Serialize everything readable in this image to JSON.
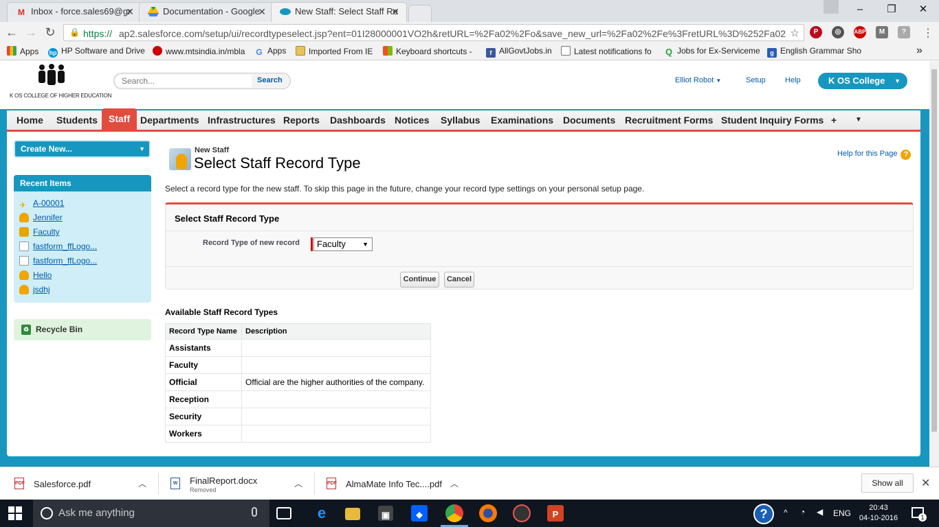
{
  "browser": {
    "tabs": [
      {
        "title": "Inbox - force.sales69@gr",
        "icon": "gmail-icon"
      },
      {
        "title": "Documentation - Google",
        "icon": "google-drive-icon"
      },
      {
        "title": "New Staff: Select Staff Re",
        "icon": "salesforce-cloud-icon"
      }
    ],
    "url_scheme": "https://",
    "url_rest": "ap2.salesforce.com/setup/ui/recordtypeselect.jsp?ent=01I28000001VO2h&retURL=%2Fa02%2Fo&save_new_url=%2Fa02%2Fe%3FretURL%3D%252Fa02%252F",
    "bookmarks": [
      "Apps",
      "HP Software and Drive",
      "www.mtsindia.in/mbla",
      "Apps",
      "Imported From IE",
      "Keyboard shortcuts -",
      "AllGovtJobs.in",
      "Latest notifications fo",
      "Jobs for Ex-Serviceme",
      "English Grammar Sho"
    ],
    "more_bookmarks": "»"
  },
  "sf": {
    "logo_caption": "K OS COLLEGE OF HIGHER EDUCATION",
    "search_placeholder": "Search...",
    "search_button": "Search",
    "user_menu": "Elliot Robot",
    "setup": "Setup",
    "help": "Help",
    "app_name": "K OS College",
    "nav_tabs": [
      "Home",
      "Students",
      "Staff",
      "Departments",
      "Infrastructures",
      "Reports",
      "Dashboards",
      "Notices",
      "Syllabus",
      "Examinations",
      "Documents",
      "Recruitment Forms",
      "Student Inquiry Forms"
    ],
    "nav_plus": "+",
    "active_tab": "Staff",
    "create_new": "Create New...",
    "recent_header": "Recent Items",
    "recent_items": [
      {
        "label": "A-00001",
        "icon": "plane-icon"
      },
      {
        "label": "Jennifer",
        "icon": "bell-icon"
      },
      {
        "label": "Faculty",
        "icon": "cylinder-icon"
      },
      {
        "label": "fastform_ffLogo...",
        "icon": "document-icon"
      },
      {
        "label": "fastform_ffLogo...",
        "icon": "document-icon"
      },
      {
        "label": "Hello",
        "icon": "bell-icon"
      },
      {
        "label": "jsdhj",
        "icon": "bell-icon"
      }
    ],
    "recycle_bin": "Recycle Bin",
    "page_type": "New Staff",
    "page_title": "Select Staff Record Type",
    "help_for_page": "Help for this Page",
    "instructions": "Select a record type for the new staff. To skip this page in the future, change your record type settings on your personal setup page.",
    "block_title": "Select Staff Record Type",
    "field_label": "Record Type of new record",
    "selected_record_type": "Faculty",
    "continue_btn": "Continue",
    "cancel_btn": "Cancel",
    "available_title": "Available Staff Record Types",
    "table_headers": [
      "Record Type Name",
      "Description"
    ],
    "table_rows": [
      {
        "name": "Assistants",
        "description": ""
      },
      {
        "name": "Faculty",
        "description": ""
      },
      {
        "name": "Official",
        "description": "Official are the higher authorities of the company."
      },
      {
        "name": "Reception",
        "description": ""
      },
      {
        "name": "Security",
        "description": ""
      },
      {
        "name": "Workers",
        "description": ""
      }
    ]
  },
  "downloads": {
    "items": [
      {
        "name": "Salesforce.pdf",
        "status": ""
      },
      {
        "name": "FinalReport.docx",
        "status": "Removed"
      },
      {
        "name": "AlmaMate Info Tec....pdf",
        "status": ""
      }
    ],
    "show_all": "Show all"
  },
  "taskbar": {
    "search_placeholder": "Ask me anything",
    "language": "ENG",
    "time": "20:43",
    "date": "04-10-2016",
    "notification_count": "1"
  },
  "colors": {
    "salesforce_blue": "#1797c0",
    "active_tab_red": "#e34b3f",
    "link_blue": "#015ba7"
  }
}
